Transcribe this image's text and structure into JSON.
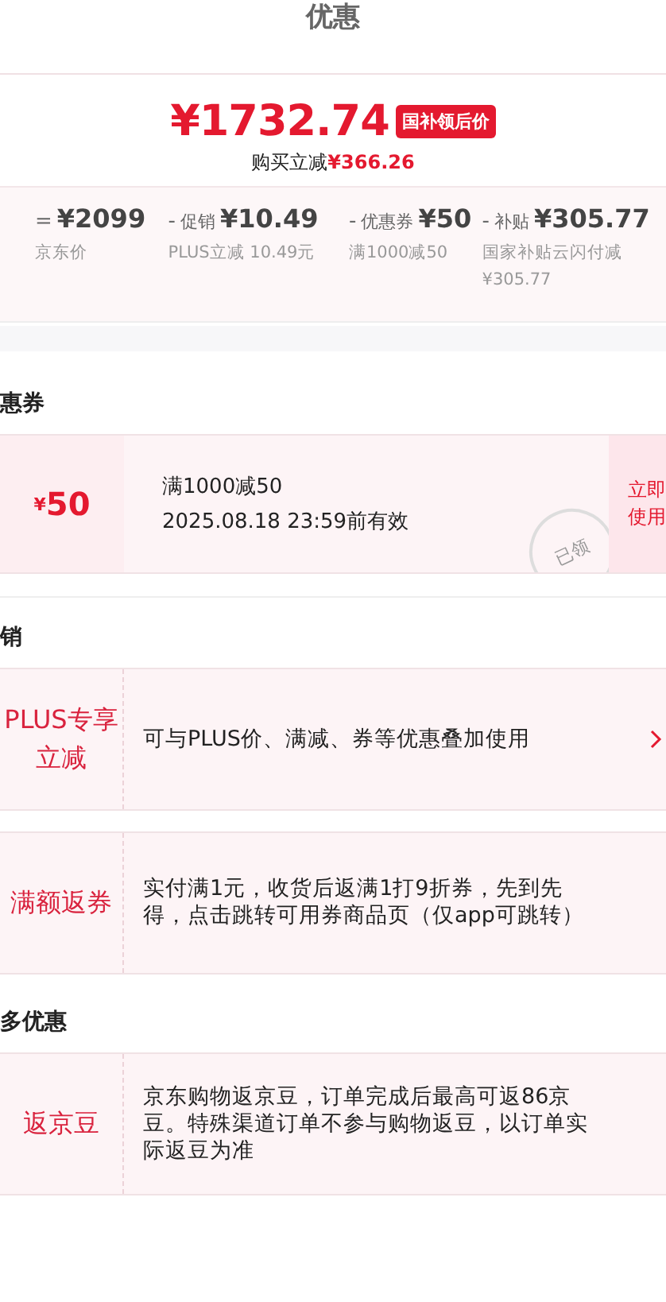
{
  "title": "优惠",
  "summary": {
    "price": "¥1732.74",
    "badge": "国补领后价",
    "saving_label": "购买立减",
    "saving": "¥366.26",
    "breakdown": [
      {
        "op": "=",
        "amount": "¥2099",
        "note": "京东价"
      },
      {
        "op": "-",
        "label": "促销",
        "amount": "¥10.49",
        "note": "PLUS立减 10.49元"
      },
      {
        "op": "-",
        "label": "优惠券",
        "amount": "¥50",
        "note": "满1000减50"
      },
      {
        "op": "-",
        "label": "补贴",
        "amount": "¥305.77",
        "note": "国家补贴云闪付减¥305.77"
      }
    ]
  },
  "coupon_section": {
    "heading": "惠券",
    "coupon": {
      "currency": "¥",
      "value": "50",
      "condition": "满1000减50",
      "validity": "2025.08.18 23:59前有效",
      "stamp": "已领",
      "action": "立即使用"
    }
  },
  "promotion_section": {
    "heading": "销",
    "items": [
      {
        "label": "PLUS专享立减",
        "text": "可与PLUS价、满减、券等优惠叠加使用",
        "arrow": true
      },
      {
        "label": "满额返券",
        "text": "实付满1元，收货后返满1打9折券，先到先得，点击跳转可用券商品页（仅app可跳转）",
        "arrow": false
      }
    ]
  },
  "more_section": {
    "heading": "多优惠",
    "items": [
      {
        "label": "返京豆",
        "text": "京东购物返京豆，订单完成后最高可返86京豆。特殊渠道订单不参与购物返豆，以订单实际返豆为准",
        "arrow": false
      }
    ]
  }
}
